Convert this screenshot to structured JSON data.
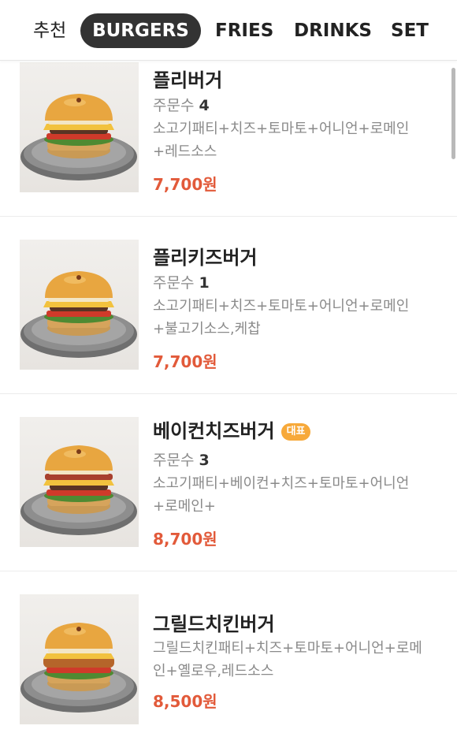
{
  "tabs": [
    {
      "label": "추천",
      "active": false
    },
    {
      "label": "BURGERS",
      "active": true
    },
    {
      "label": "FRIES",
      "active": false
    },
    {
      "label": "DRINKS",
      "active": false
    },
    {
      "label": "SET",
      "active": false
    }
  ],
  "items": [
    {
      "name": "플리버거",
      "orders_label": "주문수",
      "orders_count": "4",
      "desc_line1": "소고기패티+치즈+토마토+어니언+로메인",
      "desc_line2": "+레드소스",
      "price": "7,700원",
      "image_icon": "burger-photo"
    },
    {
      "name": "플리키즈버거",
      "orders_label": "주문수",
      "orders_count": "1",
      "desc_line1": "소고기패티+치즈+토마토+어니언+로메인",
      "desc_line2": "+불고기소스,케찹",
      "price": "7,700원",
      "image_icon": "burger-photo"
    },
    {
      "name": "베이컨치즈버거",
      "badge": "대표",
      "orders_label": "주문수",
      "orders_count": "3",
      "desc_line1": "소고기패티+베이컨+치즈+토마토+어니언",
      "desc_line2": "+로메인+",
      "price": "8,700원",
      "image_icon": "burger-photo"
    },
    {
      "name": "그릴드치킨버거",
      "desc_line1": "그릴드치킨패티+치즈+토마토+어니언+로메",
      "desc_line2": "인+옐로우,레드소스",
      "price": "8,500원",
      "image_icon": "burger-photo"
    }
  ],
  "colors": {
    "price": "#e25a3a",
    "badge": "#f7a93a",
    "active_tab_bg": "#333333"
  }
}
